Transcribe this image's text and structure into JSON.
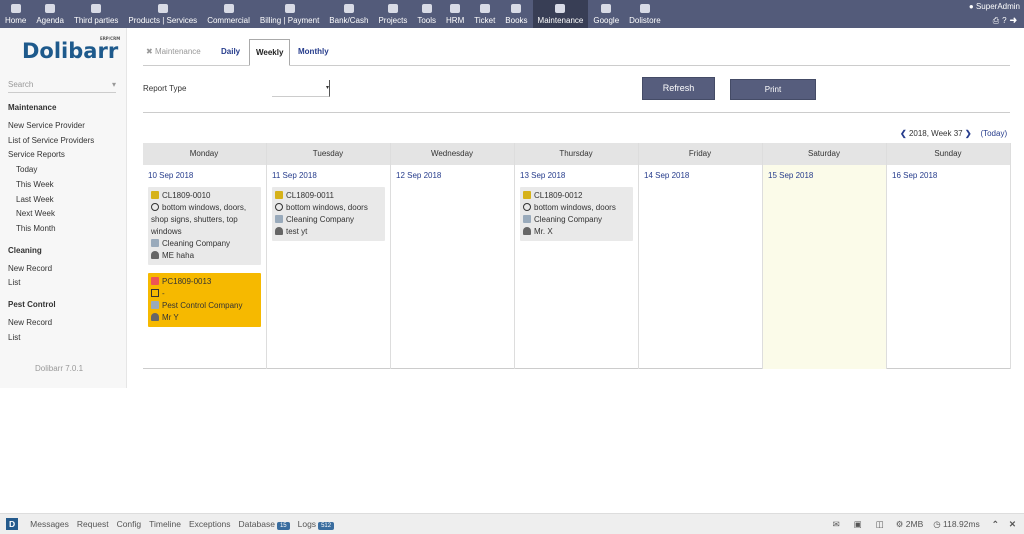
{
  "topmenu": [
    "Home",
    "Agenda",
    "Third parties",
    "Products | Services",
    "Commercial",
    "Billing | Payment",
    "Bank/Cash",
    "Projects",
    "Tools",
    "HRM",
    "Ticket",
    "Books",
    "Maintenance",
    "Google",
    "Dolistore"
  ],
  "active_menu": "Maintenance",
  "user": "SuperAdmin",
  "logo": {
    "name": "Dolibarr",
    "tag": "ERP/CRM"
  },
  "sidebar": {
    "search_placeholder": "Search",
    "sections": [
      {
        "title": "Maintenance",
        "items": [
          "New Service Provider",
          "List of Service Providers",
          "Service Reports"
        ],
        "sub": [
          "Today",
          "This Week",
          "Last Week",
          "Next Week",
          "This Month"
        ]
      },
      {
        "title": "Cleaning",
        "items": [
          "New Record",
          "List"
        ]
      },
      {
        "title": "Pest Control",
        "items": [
          "New Record",
          "List"
        ]
      }
    ],
    "version": "Dolibarr 7.0.1"
  },
  "tabs": {
    "module": "Maintenance",
    "items": [
      "Daily",
      "Weekly",
      "Monthly"
    ],
    "selected": "Weekly"
  },
  "filter": {
    "report_type_label": "Report Type",
    "report_type_value": ""
  },
  "buttons": {
    "refresh": "Refresh",
    "print": "Print"
  },
  "week_nav": {
    "label": "2018, Week 37",
    "today": "(Today)"
  },
  "calendar": {
    "days": [
      {
        "name": "Monday",
        "date": "10 Sep 2018",
        "events": [
          {
            "ref": "CL1809-0010",
            "desc": "bottom windows, doors, shop signs, shutters, top windows",
            "company": "Cleaning Company",
            "person": "ME haha",
            "type": "cleaning"
          },
          {
            "ref": "PC1809-0013",
            "desc": "-",
            "company": "Pest Control Company",
            "person": "Mr Y",
            "type": "pest"
          }
        ]
      },
      {
        "name": "Tuesday",
        "date": "11 Sep 2018",
        "events": [
          {
            "ref": "CL1809-0011",
            "desc": "bottom windows, doors",
            "company": "Cleaning Company",
            "person": "test yt",
            "type": "cleaning"
          }
        ]
      },
      {
        "name": "Wednesday",
        "date": "12 Sep 2018",
        "events": []
      },
      {
        "name": "Thursday",
        "date": "13 Sep 2018",
        "events": [
          {
            "ref": "CL1809-0012",
            "desc": "bottom windows, doors",
            "company": "Cleaning Company",
            "person": "Mr. X",
            "type": "cleaning"
          }
        ]
      },
      {
        "name": "Friday",
        "date": "14 Sep 2018",
        "events": []
      },
      {
        "name": "Saturday",
        "date": "15 Sep 2018",
        "events": [],
        "today": true
      },
      {
        "name": "Sunday",
        "date": "16 Sep 2018",
        "events": []
      }
    ]
  },
  "debugbar": {
    "items": [
      "Messages",
      "Request",
      "Config",
      "Timeline",
      "Exceptions",
      "Database",
      "Logs"
    ],
    "database_count": "15",
    "logs_count": "512",
    "memory": "2MB",
    "time": "118.92ms"
  }
}
